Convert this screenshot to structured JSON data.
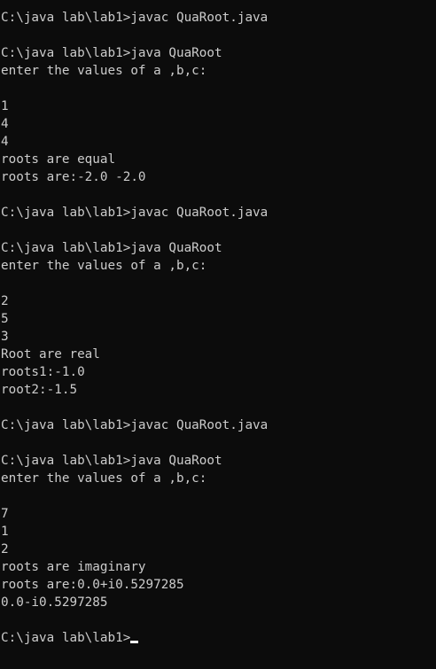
{
  "console": {
    "lines": [
      "C:\\java lab\\lab1>javac QuaRoot.java",
      "",
      "C:\\java lab\\lab1>java QuaRoot",
      "enter the values of a ,b,c:",
      "",
      "1",
      "4",
      "4",
      "roots are equal",
      "roots are:-2.0 -2.0",
      "",
      "C:\\java lab\\lab1>javac QuaRoot.java",
      "",
      "C:\\java lab\\lab1>java QuaRoot",
      "enter the values of a ,b,c:",
      "",
      "2",
      "5",
      "3",
      "Root are real",
      "roots1:-1.0",
      "root2:-1.5",
      "",
      "C:\\java lab\\lab1>javac QuaRoot.java",
      "",
      "C:\\java lab\\lab1>java QuaRoot",
      "enter the values of a ,b,c:",
      "",
      "7",
      "1",
      "2",
      "roots are imaginary",
      "roots are:0.0+i0.5297285",
      "0.0-i0.5297285",
      "",
      "C:\\java lab\\lab1>"
    ]
  }
}
